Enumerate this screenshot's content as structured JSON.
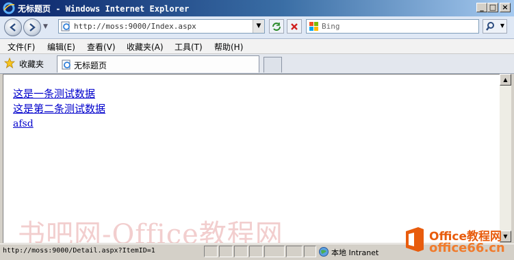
{
  "window": {
    "title": "无标题页 - Windows Internet Explorer",
    "controls": {
      "minimize": "_",
      "maximize": "□",
      "close": "×"
    }
  },
  "address_bar": {
    "url": "http://moss:9000/Index.aspx",
    "refresh_icon": "refresh-icon",
    "stop_icon": "stop-icon"
  },
  "search": {
    "placeholder": "Bing",
    "provider_icon": "bing-icon"
  },
  "menu": {
    "items": [
      "文件(F)",
      "编辑(E)",
      "查看(V)",
      "收藏夹(A)",
      "工具(T)",
      "帮助(H)"
    ]
  },
  "favorites_bar": {
    "favorites_label": "收藏夹",
    "tabs": [
      {
        "label": "无标题页"
      }
    ]
  },
  "content": {
    "links": [
      "这是一条测试数据",
      "这是第二条测试数据",
      "afsd"
    ]
  },
  "status_bar": {
    "text": "http://moss:9000/Detail.aspx?ItemID=1",
    "zone": "本地 Intranet"
  },
  "watermark": {
    "text": "书吧网-Office教程网"
  },
  "logo": {
    "line1": "Office教程网",
    "line2": "office66.cn"
  },
  "colors": {
    "title_bar": "#0a246a",
    "link": "#0000cc",
    "logo_orange": "#e85c0d"
  }
}
